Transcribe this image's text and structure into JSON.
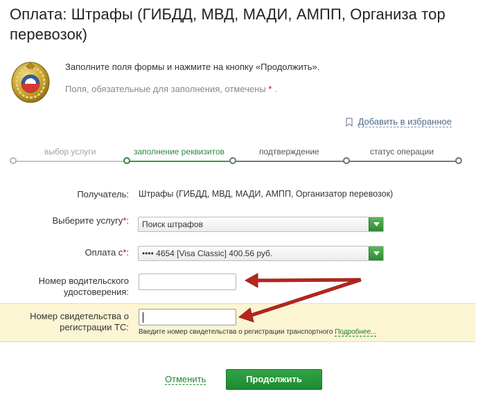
{
  "page": {
    "title": "Оплата: Штрафы (ГИБДД, МВД, МАДИ, АМПП, Организа тор перевозок)",
    "intro": "Заполните поля формы и нажмите на кнопку «Продолжить».",
    "required_note": "Поля, обязательные для заполнения, отмечены",
    "required_star": "*",
    "required_note_end": "."
  },
  "favorites": {
    "label": "Добавить в избранное",
    "icon": "bookmark-icon"
  },
  "steps": [
    {
      "label": "выбор услуги",
      "state": "done",
      "color": "#aaaaaa"
    },
    {
      "label": "заполнение реквизитов",
      "state": "current",
      "color": "#2a8a3a"
    },
    {
      "label": "подтверждение",
      "state": "pending",
      "color": "#555555"
    },
    {
      "label": "статус операции",
      "state": "pending",
      "color": "#555555"
    }
  ],
  "form": {
    "recipient": {
      "label": "Получатель:",
      "value": "Штрафы (ГИБДД, МВД, МАДИ, АМПП, Организатор перевозок)"
    },
    "service": {
      "label": "Выберите услугу",
      "required_mark": "*",
      "label_end": ":",
      "value": "Поиск штрафов"
    },
    "payment_from": {
      "label": "Оплата с",
      "required_mark": "*",
      "label_end": ":",
      "value": "•••• 4654 [Visa Classic] 400.56 руб."
    },
    "driver_license": {
      "label_line1": "Номер водительского",
      "label_line2": "удостоверения:",
      "value": ""
    },
    "vehicle_cert": {
      "label_line1": "Номер свидетельства о",
      "label_line2": "регистрации ТС:",
      "value": "",
      "hint": "Введите номер свидетельства о регистрации транспортного",
      "hint_link": "Подробнее..."
    }
  },
  "actions": {
    "cancel": "Отменить",
    "continue": "Продолжить"
  },
  "colors": {
    "accent": "#2a8a3a",
    "highlight": "#fbf5d3",
    "arrow": "#b8261e"
  }
}
